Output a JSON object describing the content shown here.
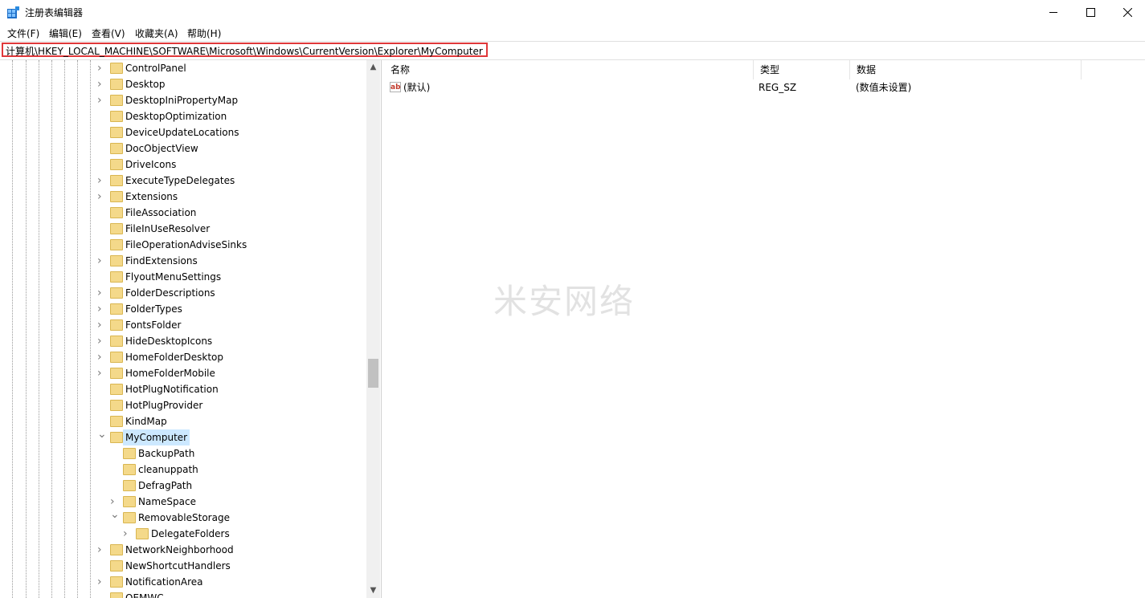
{
  "window": {
    "title": "注册表编辑器",
    "minimize": "—",
    "maximize": "☐",
    "close": "✕"
  },
  "menu": [
    "文件(F)",
    "编辑(E)",
    "查看(V)",
    "收藏夹(A)",
    "帮助(H)"
  ],
  "address": "计算机\\HKEY_LOCAL_MACHINE\\SOFTWARE\\Microsoft\\Windows\\CurrentVersion\\Explorer\\MyComputer",
  "tree": [
    {
      "label": "ControlPanel",
      "level": 0,
      "chevron": "right"
    },
    {
      "label": "Desktop",
      "level": 0,
      "chevron": "right"
    },
    {
      "label": "DesktopIniPropertyMap",
      "level": 0,
      "chevron": "right"
    },
    {
      "label": "DesktopOptimization",
      "level": 0,
      "chevron": "none"
    },
    {
      "label": "DeviceUpdateLocations",
      "level": 0,
      "chevron": "none"
    },
    {
      "label": "DocObjectView",
      "level": 0,
      "chevron": "none"
    },
    {
      "label": "DriveIcons",
      "level": 0,
      "chevron": "none"
    },
    {
      "label": "ExecuteTypeDelegates",
      "level": 0,
      "chevron": "right"
    },
    {
      "label": "Extensions",
      "level": 0,
      "chevron": "right"
    },
    {
      "label": "FileAssociation",
      "level": 0,
      "chevron": "none"
    },
    {
      "label": "FileInUseResolver",
      "level": 0,
      "chevron": "none"
    },
    {
      "label": "FileOperationAdviseSinks",
      "level": 0,
      "chevron": "none"
    },
    {
      "label": "FindExtensions",
      "level": 0,
      "chevron": "right"
    },
    {
      "label": "FlyoutMenuSettings",
      "level": 0,
      "chevron": "none"
    },
    {
      "label": "FolderDescriptions",
      "level": 0,
      "chevron": "right"
    },
    {
      "label": "FolderTypes",
      "level": 0,
      "chevron": "right"
    },
    {
      "label": "FontsFolder",
      "level": 0,
      "chevron": "right"
    },
    {
      "label": "HideDesktopIcons",
      "level": 0,
      "chevron": "right"
    },
    {
      "label": "HomeFolderDesktop",
      "level": 0,
      "chevron": "right"
    },
    {
      "label": "HomeFolderMobile",
      "level": 0,
      "chevron": "right"
    },
    {
      "label": "HotPlugNotification",
      "level": 0,
      "chevron": "none"
    },
    {
      "label": "HotPlugProvider",
      "level": 0,
      "chevron": "none"
    },
    {
      "label": "KindMap",
      "level": 0,
      "chevron": "none"
    },
    {
      "label": "MyComputer",
      "level": 0,
      "chevron": "down",
      "selected": true
    },
    {
      "label": "BackupPath",
      "level": 1,
      "chevron": "none"
    },
    {
      "label": "cleanuppath",
      "level": 1,
      "chevron": "none"
    },
    {
      "label": "DefragPath",
      "level": 1,
      "chevron": "none"
    },
    {
      "label": "NameSpace",
      "level": 1,
      "chevron": "right"
    },
    {
      "label": "RemovableStorage",
      "level": 1,
      "chevron": "down"
    },
    {
      "label": "DelegateFolders",
      "level": 2,
      "chevron": "right"
    },
    {
      "label": "NetworkNeighborhood",
      "level": 0,
      "chevron": "right"
    },
    {
      "label": "NewShortcutHandlers",
      "level": 0,
      "chevron": "none"
    },
    {
      "label": "NotificationArea",
      "level": 0,
      "chevron": "right"
    },
    {
      "label": "OEMWC",
      "level": 0,
      "chevron": "none"
    }
  ],
  "columns": {
    "name": "名称",
    "type": "类型",
    "data": "数据"
  },
  "values": [
    {
      "name": "(默认)",
      "type": "REG_SZ",
      "data": "(数值未设置)",
      "icon": "string-value-icon",
      "icon_text": "ab"
    }
  ],
  "watermark": "米安网络",
  "colors": {
    "selection": "#cce8ff",
    "address_highlight": "#e0383a",
    "folder": "#f4d98a"
  }
}
